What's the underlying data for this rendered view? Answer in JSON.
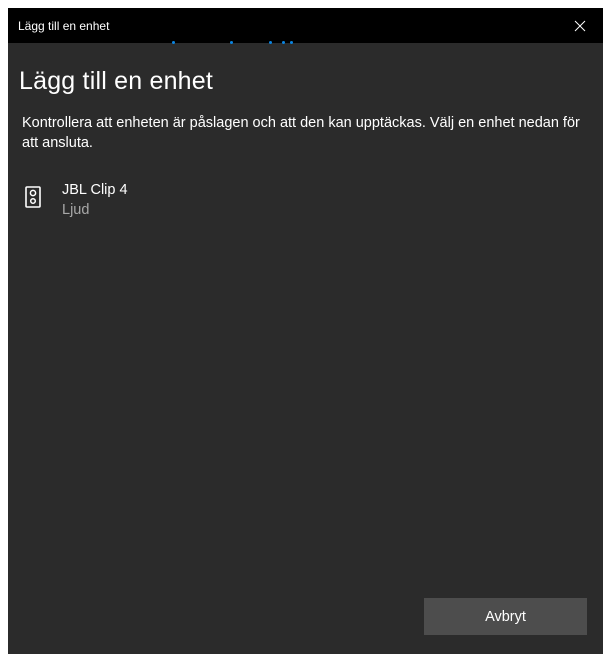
{
  "window": {
    "title": "Lägg till en enhet"
  },
  "main": {
    "heading": "Lägg till en enhet",
    "description": "Kontrollera att enheten är påslagen och att den kan upptäckas. Välj en enhet nedan för att ansluta."
  },
  "devices": [
    {
      "name": "JBL Clip 4",
      "type": "Ljud",
      "icon": "speaker-icon"
    }
  ],
  "footer": {
    "cancel_label": "Avbryt"
  },
  "colors": {
    "background": "#2b2b2b",
    "titlebar": "#000000",
    "accent": "#0a84e0",
    "button": "#4d4d4d",
    "secondary_text": "#a8a8a8"
  }
}
